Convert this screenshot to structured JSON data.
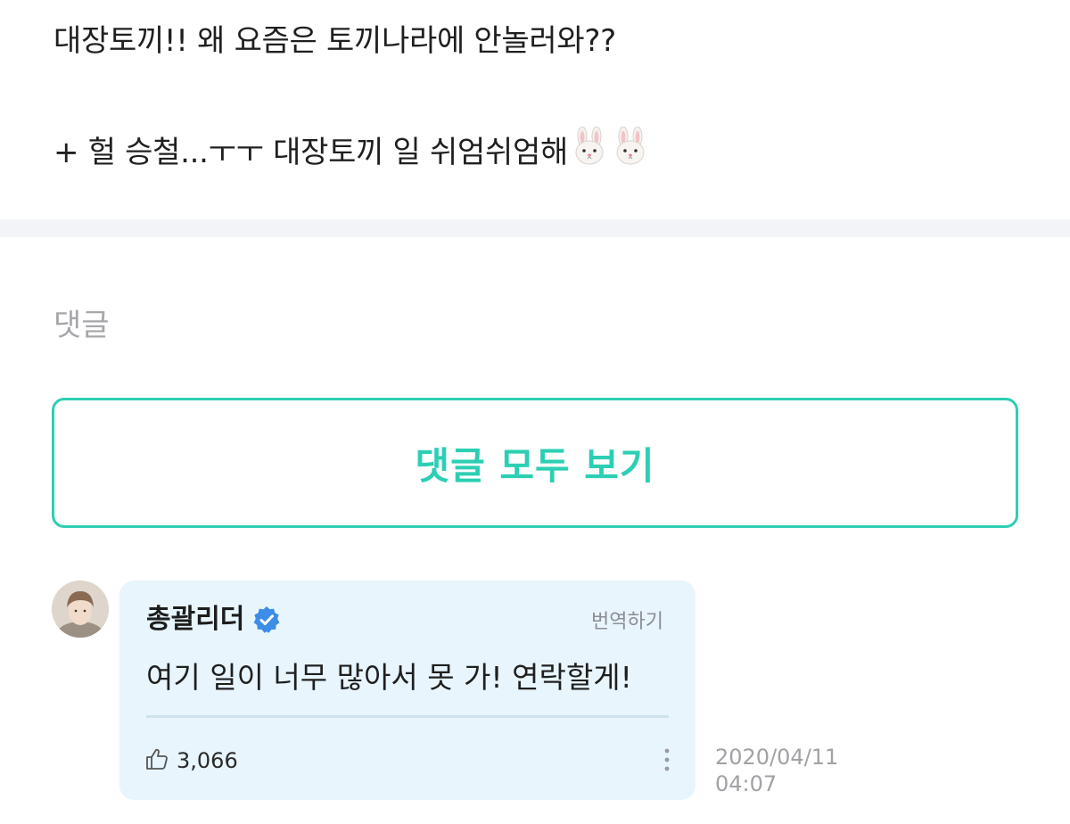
{
  "post": {
    "line1": "대장토끼!! 왜 요즘은 토끼나라에 안놀러와??",
    "line2": "+ 헐 승철...ㅜㅜ 대장토끼 일 쉬엄쉬엄해",
    "emoji": [
      "rabbit-face",
      "rabbit-face"
    ]
  },
  "comments_section": {
    "heading": "댓글",
    "view_all_label": "댓글 모두 보기",
    "accent_color": "#2ccfb3"
  },
  "comment": {
    "author": "총괄리더",
    "verified": true,
    "translate_label": "번역하기",
    "text": "여기 일이 너무 많아서 못 가! 연락할게!",
    "likes": "3,066",
    "date": "2020/04/11",
    "time": "04:07",
    "bubble_color": "#e8f5fd",
    "verified_color": "#3b8de8"
  }
}
